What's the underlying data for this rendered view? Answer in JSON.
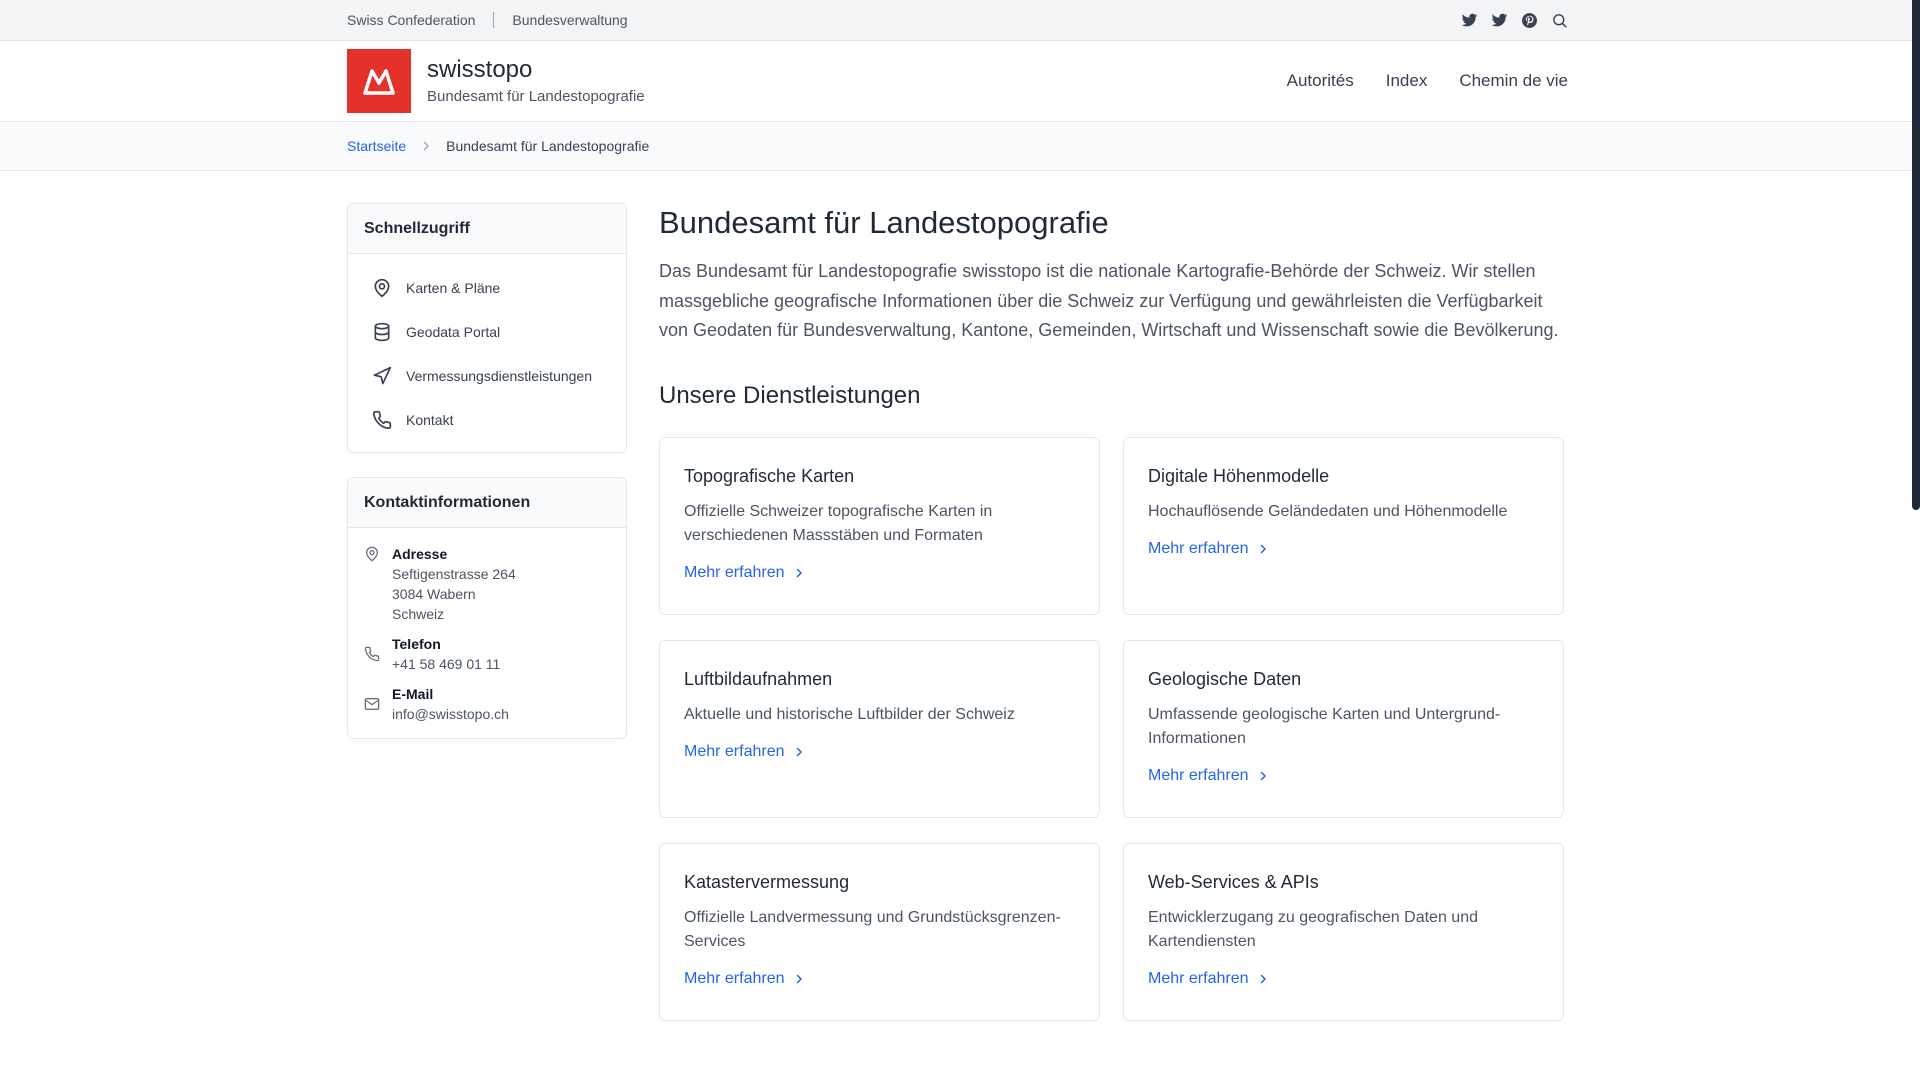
{
  "topbar": {
    "links": [
      "Swiss Confederation",
      "Bundesverwaltung"
    ],
    "icons": [
      "twitter-icon",
      "twitter-icon",
      "pinterest-icon",
      "search-icon"
    ]
  },
  "header": {
    "logo_icon": "mountain-logo-icon",
    "brand_name": "swisstopo",
    "brand_sub": "Bundesamt für Landestopografie",
    "nav": [
      "Autorités",
      "Index",
      "Chemin de vie"
    ]
  },
  "breadcrumb": {
    "home": "Startseite",
    "current": "Bundesamt für Landestopografie"
  },
  "sidebar": {
    "quick_title": "Schnellzugriff",
    "quick_items": [
      {
        "label": "Karten & Pläne",
        "icon": "map-pin-icon"
      },
      {
        "label": "Geodata Portal",
        "icon": "database-icon"
      },
      {
        "label": "Vermessungsdienstleistungen",
        "icon": "navigation-icon"
      },
      {
        "label": "Kontakt",
        "icon": "phone-icon"
      }
    ],
    "contact_title": "Kontaktinformationen",
    "contact": {
      "address_label": "Adresse",
      "address_lines": [
        "Seftigenstrasse 264",
        "3084 Wabern",
        "Schweiz"
      ],
      "phone_label": "Telefon",
      "phone": "+41 58 469 01 11",
      "email_label": "E-Mail",
      "email": "info@swisstopo.ch"
    }
  },
  "main": {
    "title": "Bundesamt für Landestopografie",
    "intro": "Das Bundesamt für Landestopografie swisstopo ist die nationale Kartografie-Behörde der Schweiz. Wir stellen massgebliche geografische Informationen über die Schweiz zur Verfügung und gewährleisten die Verfügbarkeit von Geodaten für Bundesverwaltung, Kantone, Gemeinden, Wirtschaft und Wissenschaft sowie die Bevölkerung.",
    "services_title": "Unsere Dienstleistungen",
    "services": [
      {
        "title": "Topografische Karten",
        "desc": "Offizielle Schweizer topografische Karten in verschiedenen Massstäben und Formaten",
        "link": "Mehr erfahren"
      },
      {
        "title": "Digitale Höhenmodelle",
        "desc": "Hochauflösende Geländedaten und Höhenmodelle",
        "link": "Mehr erfahren"
      },
      {
        "title": "Luftbildaufnahmen",
        "desc": "Aktuelle und historische Luftbilder der Schweiz",
        "link": "Mehr erfahren"
      },
      {
        "title": "Geologische Daten",
        "desc": "Umfassende geologische Karten und Untergrund-Informationen",
        "link": "Mehr erfahren"
      },
      {
        "title": "Katastervermessung",
        "desc": "Offizielle Landvermessung und Grundstücksgrenzen-Services",
        "link": "Mehr erfahren"
      },
      {
        "title": "Web-Services & APIs",
        "desc": "Entwicklerzugang zu geografischen Daten und Kartendiensten",
        "link": "Mehr erfahren"
      }
    ]
  },
  "colors": {
    "brand_red": "#e4312b",
    "link_blue": "#2563eb"
  }
}
